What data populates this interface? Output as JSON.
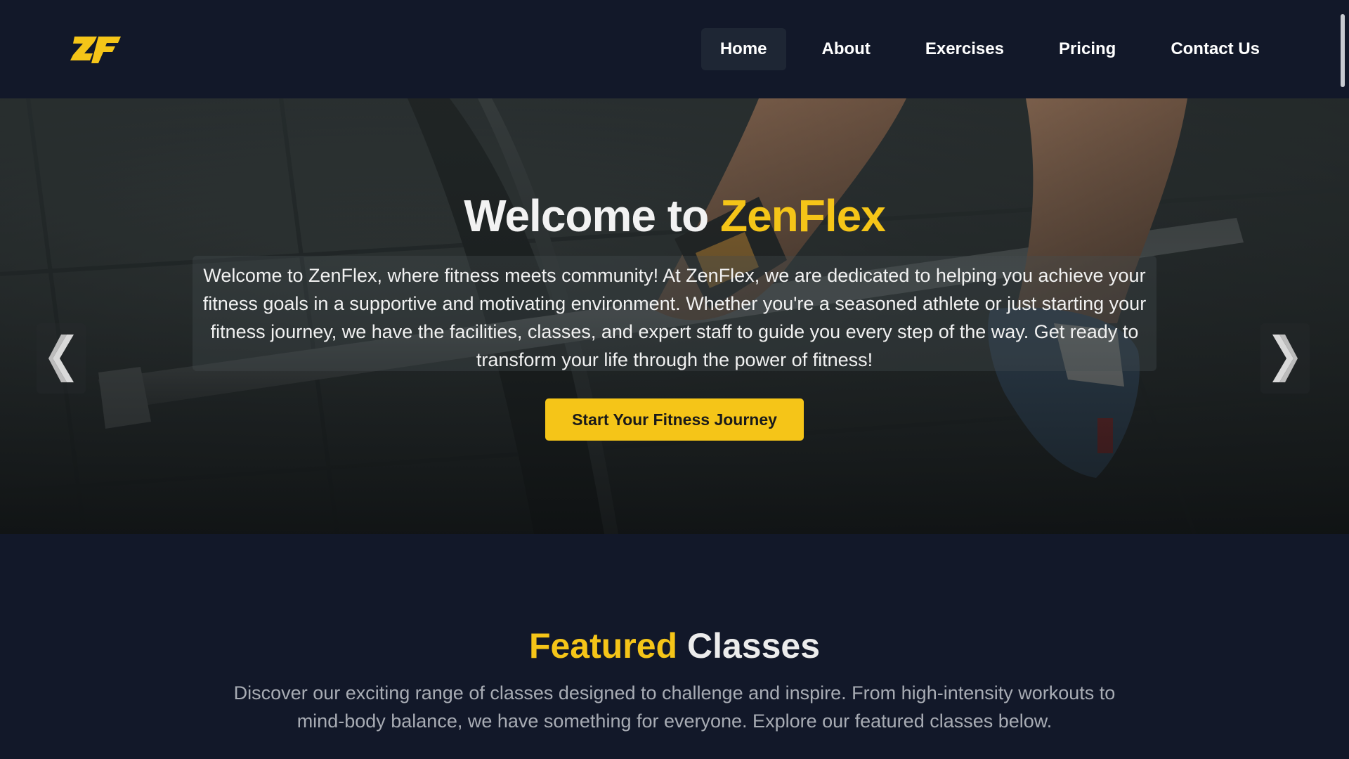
{
  "brand": {
    "logo_text": "ZF",
    "accent_color": "#f5c518"
  },
  "nav": {
    "items": [
      {
        "label": "Home",
        "active": true
      },
      {
        "label": "About"
      },
      {
        "label": "Exercises"
      },
      {
        "label": "Pricing"
      },
      {
        "label": "Contact Us"
      }
    ]
  },
  "hero": {
    "title_prefix": "Welcome to ",
    "title_brand": "ZenFlex",
    "description": "Welcome to ZenFlex, where fitness meets community! At ZenFlex, we are dedicated to helping you achieve your fitness goals in a supportive and motivating environment. Whether you're a seasoned athlete or just starting your fitness journey, we have the facilities, classes, and expert staff to guide you every step of the way. Get ready to transform your life through the power of fitness!",
    "cta_label": "Start Your Fitness Journey",
    "prev_icon": "chevron-left-icon",
    "next_icon": "chevron-right-icon"
  },
  "featured": {
    "title_accent": "Featured",
    "title_rest": " Classes",
    "description": "Discover our exciting range of classes designed to challenge and inspire. From high-intensity workouts to mind-body balance, we have something for everyone. Explore our featured classes below."
  }
}
